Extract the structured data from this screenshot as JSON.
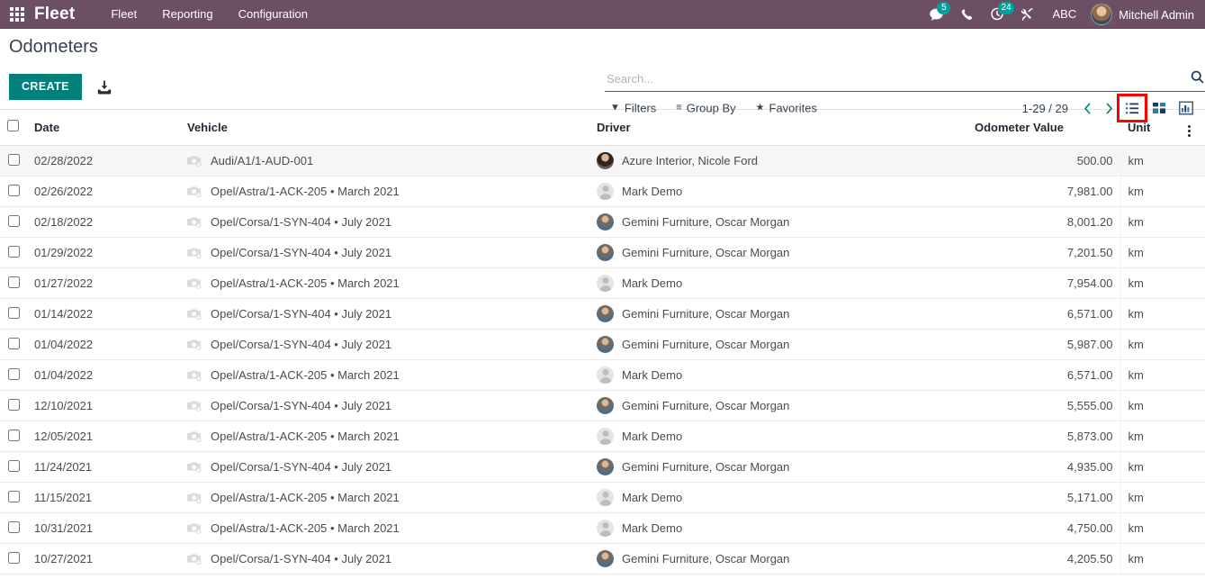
{
  "navbar": {
    "apps_label": "apps-grid",
    "brand": "Fleet",
    "menus": [
      {
        "label": "Fleet"
      },
      {
        "label": "Reporting"
      },
      {
        "label": "Configuration"
      }
    ],
    "messages_badge": "5",
    "activities_badge": "24",
    "debug_label": "ABC",
    "user_name": "Mitchell Admin"
  },
  "control_panel": {
    "title": "Odometers",
    "create_label": "CREATE",
    "search_placeholder": "Search...",
    "search_value": "",
    "filters_label": "Filters",
    "group_by_label": "Group By",
    "favorites_label": "Favorites",
    "pager": "1-29 / 29",
    "views": [
      {
        "name": "list",
        "active": true
      },
      {
        "name": "kanban",
        "active": false
      },
      {
        "name": "graph",
        "active": false
      }
    ]
  },
  "table": {
    "columns": [
      "Date",
      "Vehicle",
      "Driver",
      "Odometer Value",
      "Unit"
    ],
    "rows": [
      {
        "date": "02/28/2022",
        "vehicle": "Audi/A1/1-AUD-001",
        "driver": "Azure Interior, Nicole Ford",
        "avatar": "nicole",
        "odometer": "500.00",
        "unit": "km"
      },
      {
        "date": "02/26/2022",
        "vehicle": "Opel/Astra/1-ACK-205 • March 2021",
        "driver": "Mark Demo",
        "avatar": "generic",
        "odometer": "7,981.00",
        "unit": "km"
      },
      {
        "date": "02/18/2022",
        "vehicle": "Opel/Corsa/1-SYN-404 • July 2021",
        "driver": "Gemini Furniture, Oscar Morgan",
        "avatar": "oscar",
        "odometer": "8,001.20",
        "unit": "km"
      },
      {
        "date": "01/29/2022",
        "vehicle": "Opel/Corsa/1-SYN-404 • July 2021",
        "driver": "Gemini Furniture, Oscar Morgan",
        "avatar": "oscar",
        "odometer": "7,201.50",
        "unit": "km"
      },
      {
        "date": "01/27/2022",
        "vehicle": "Opel/Astra/1-ACK-205 • March 2021",
        "driver": "Mark Demo",
        "avatar": "generic",
        "odometer": "7,954.00",
        "unit": "km"
      },
      {
        "date": "01/14/2022",
        "vehicle": "Opel/Corsa/1-SYN-404 • July 2021",
        "driver": "Gemini Furniture, Oscar Morgan",
        "avatar": "oscar",
        "odometer": "6,571.00",
        "unit": "km"
      },
      {
        "date": "01/04/2022",
        "vehicle": "Opel/Corsa/1-SYN-404 • July 2021",
        "driver": "Gemini Furniture, Oscar Morgan",
        "avatar": "oscar",
        "odometer": "5,987.00",
        "unit": "km"
      },
      {
        "date": "01/04/2022",
        "vehicle": "Opel/Astra/1-ACK-205 • March 2021",
        "driver": "Mark Demo",
        "avatar": "generic",
        "odometer": "6,571.00",
        "unit": "km"
      },
      {
        "date": "12/10/2021",
        "vehicle": "Opel/Corsa/1-SYN-404 • July 2021",
        "driver": "Gemini Furniture, Oscar Morgan",
        "avatar": "oscar",
        "odometer": "5,555.00",
        "unit": "km"
      },
      {
        "date": "12/05/2021",
        "vehicle": "Opel/Astra/1-ACK-205 • March 2021",
        "driver": "Mark Demo",
        "avatar": "generic",
        "odometer": "5,873.00",
        "unit": "km"
      },
      {
        "date": "11/24/2021",
        "vehicle": "Opel/Corsa/1-SYN-404 • July 2021",
        "driver": "Gemini Furniture, Oscar Morgan",
        "avatar": "oscar",
        "odometer": "4,935.00",
        "unit": "km"
      },
      {
        "date": "11/15/2021",
        "vehicle": "Opel/Astra/1-ACK-205 • March 2021",
        "driver": "Mark Demo",
        "avatar": "generic",
        "odometer": "5,171.00",
        "unit": "km"
      },
      {
        "date": "10/31/2021",
        "vehicle": "Opel/Astra/1-ACK-205 • March 2021",
        "driver": "Mark Demo",
        "avatar": "generic",
        "odometer": "4,750.00",
        "unit": "km"
      },
      {
        "date": "10/27/2021",
        "vehicle": "Opel/Corsa/1-SYN-404 • July 2021",
        "driver": "Gemini Furniture, Oscar Morgan",
        "avatar": "oscar",
        "odometer": "4,205.50",
        "unit": "km"
      }
    ]
  },
  "colors": {
    "navbar": "#6d4f63",
    "accent": "#00807b",
    "badge": "#00a09d",
    "highlight_box": "#ff0000"
  }
}
